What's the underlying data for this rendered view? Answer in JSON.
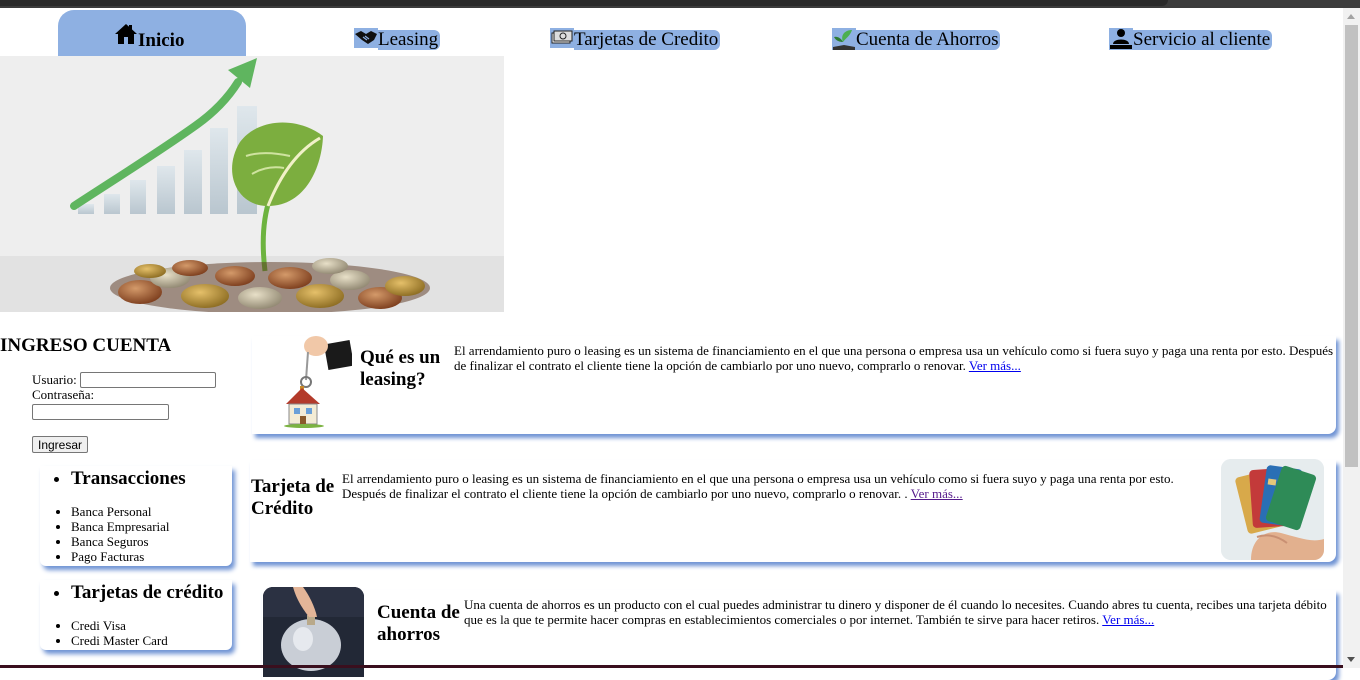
{
  "nav": {
    "items": [
      {
        "label": "Inicio",
        "icon": "home-icon",
        "active": true
      },
      {
        "label": "Leasing",
        "icon": "handshake-icon",
        "active": false
      },
      {
        "label": "Tarjetas de Credito",
        "icon": "money-icon",
        "active": false
      },
      {
        "label": "Cuenta de Ahorros",
        "icon": "plant-hand-icon",
        "active": false
      },
      {
        "label": "Servicio al cliente",
        "icon": "customer-service-icon",
        "active": false
      }
    ],
    "accent": "#8eb0e2"
  },
  "login": {
    "title": "INGRESO CUENTA",
    "user_label": "Usuario:",
    "user_value": "",
    "pass_label": "Contraseña:",
    "pass_value": "",
    "submit_label": "Ingresar"
  },
  "sidebar": {
    "groups": [
      {
        "title": "Transacciones",
        "items": [
          "Banca Personal",
          "Banca Empresarial",
          "Banca Seguros",
          "Pago Facturas"
        ]
      },
      {
        "title": "Tarjetas de crédito",
        "items": [
          "Credi Visa",
          "Credi Master Card"
        ]
      }
    ]
  },
  "cards": [
    {
      "title": "Qué es un leasing?",
      "text": "El arrendamiento puro o leasing es un sistema de financiamiento en el que una persona o empresa usa un vehículo como si fuera suyo y paga una renta por esto. Después de finalizar el contrato el cliente tiene la opción de cambiarlo por uno nuevo, comprarlo o renovar.",
      "link": "Ver más..."
    },
    {
      "title": "Tarjeta de Crédito",
      "text": "El arrendamiento puro o leasing es un sistema de financiamiento en el que una persona o empresa usa un vehículo como si fuera suyo y paga una renta por esto. Después de finalizar el contrato el cliente tiene la opción de cambiarlo por uno nuevo, comprarlo o renovar. .",
      "link": "Ver más..."
    },
    {
      "title": "Cuenta de ahorros",
      "text": "Una cuenta de ahorros es un producto con el cual puedes administrar tu dinero y disponer de él cuando lo necesites. Cuando abres tu cuenta, recibes una tarjeta débito que es la que te permite hacer compras en establecimientos comerciales o por internet. También te sirve para hacer retiros.",
      "link": "Ver más..."
    }
  ],
  "colors": {
    "card_shadow": "#6f93d4",
    "link": "#0000ee",
    "visited_link": "#551a8b"
  }
}
